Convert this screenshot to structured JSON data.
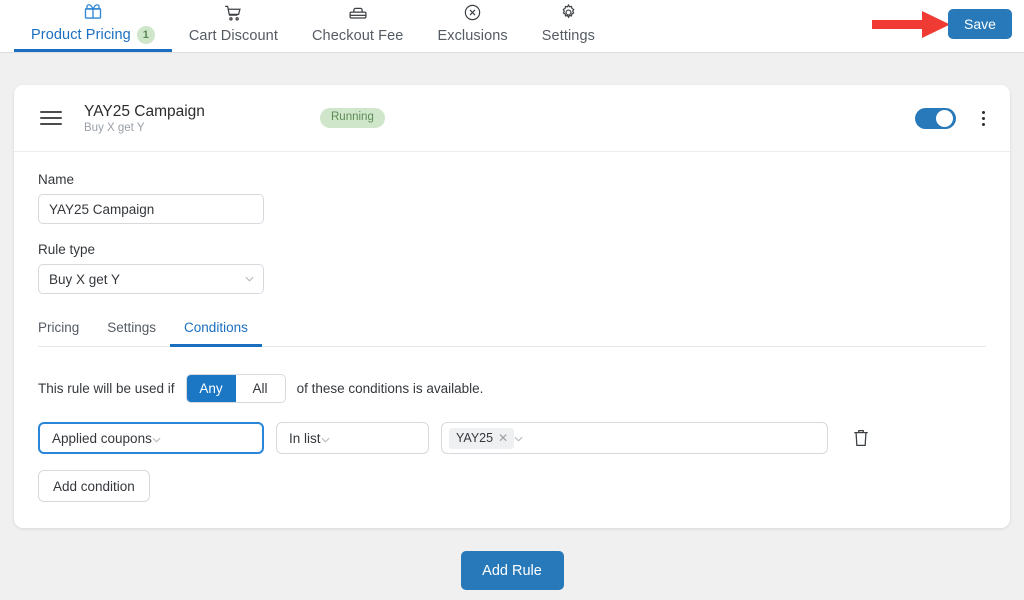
{
  "nav": {
    "tabs": [
      {
        "label": "Product Pricing",
        "icon": "gift-icon",
        "active": true,
        "badge": "1"
      },
      {
        "label": "Cart Discount",
        "icon": "shopping-cart-icon",
        "active": false,
        "badge": ""
      },
      {
        "label": "Checkout Fee",
        "icon": "checkout-counter-icon",
        "active": false,
        "badge": ""
      },
      {
        "label": "Exclusions",
        "icon": "circle-x-icon",
        "active": false,
        "badge": ""
      },
      {
        "label": "Settings",
        "icon": "gear-icon",
        "active": false,
        "badge": ""
      }
    ],
    "save_label": "Save",
    "accent_color": "#1b6fc0",
    "save_bg": "#2879b9",
    "arrow_color": "#ef3b33"
  },
  "rule_card": {
    "title": "YAY25 Campaign",
    "subtitle": "Buy X get Y",
    "status": "Running",
    "status_bg": "#cfe6cb",
    "status_color": "#5e8c57",
    "toggle_on": true,
    "drag_handle": "drag-handle-icon",
    "menu_icon": "kebab-menu-icon",
    "name": {
      "label": "Name",
      "value": "YAY25 Campaign",
      "placeholder": "Name"
    },
    "rule_type": {
      "label": "Rule type",
      "value": "Buy X get Y"
    },
    "inner_tabs": [
      {
        "label": "Pricing",
        "active": false
      },
      {
        "label": "Settings",
        "active": false
      },
      {
        "label": "Conditions",
        "active": true
      }
    ],
    "conditions": {
      "intro_prefix": "This rule will be used if",
      "intro_suffix": "of these conditions is available.",
      "match_options": [
        {
          "label": "Any",
          "selected": true
        },
        {
          "label": "All",
          "selected": false
        }
      ],
      "rows": [
        {
          "field": "Applied coupons",
          "operator": "In list",
          "tags": [
            "YAY25"
          ],
          "delete_icon": "trash-icon"
        }
      ],
      "add_condition_label": "Add condition"
    }
  },
  "footer": {
    "add_rule_label": "Add Rule"
  }
}
